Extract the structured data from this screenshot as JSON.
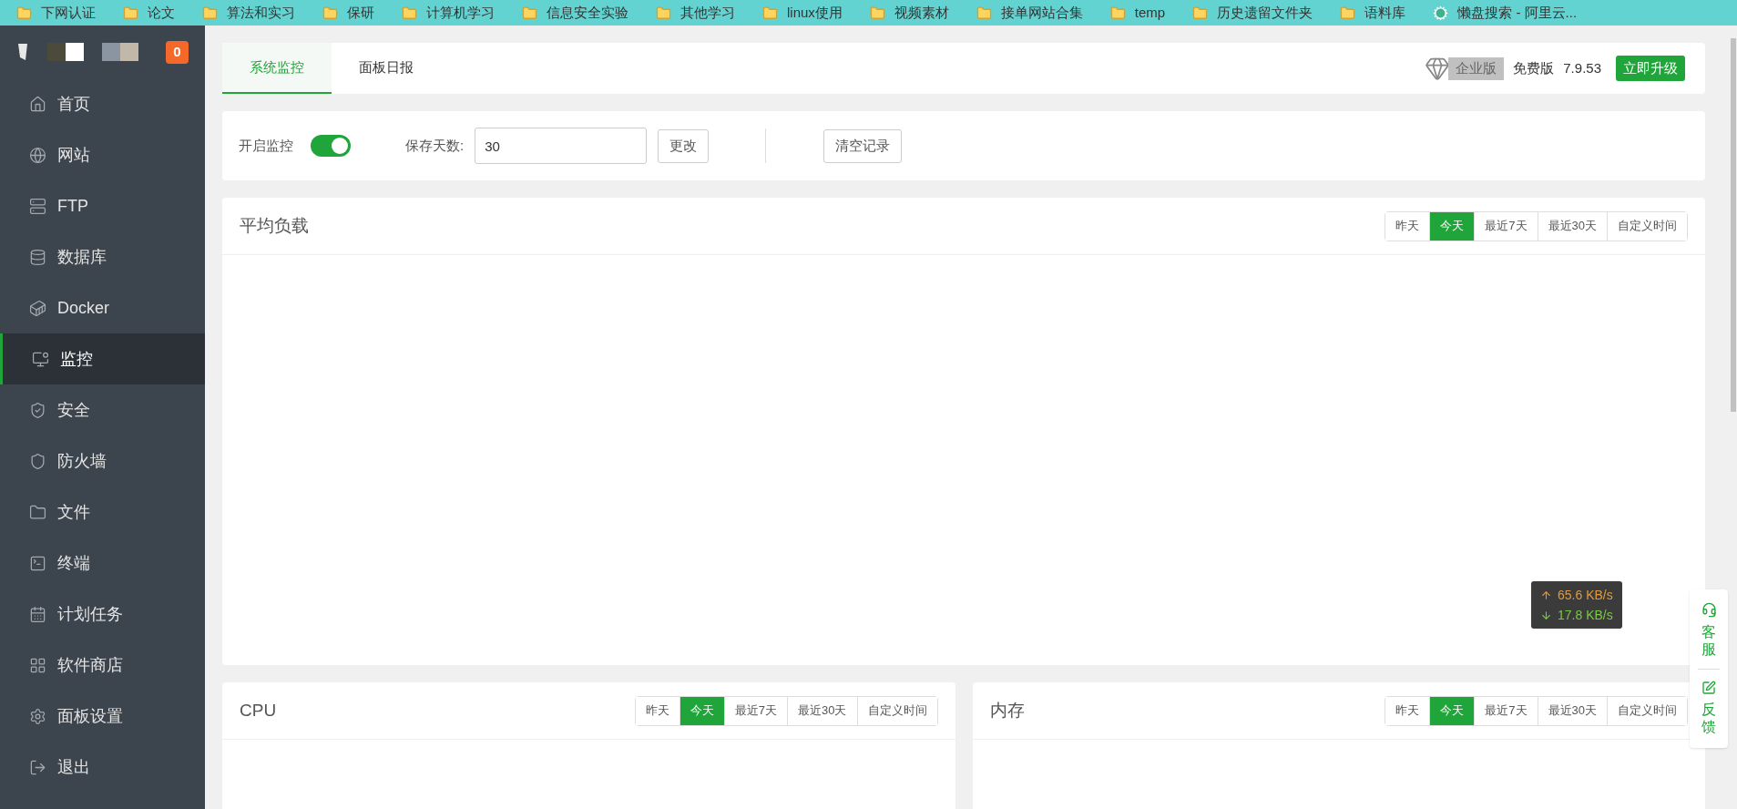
{
  "bookmarks": [
    {
      "label": "下网认证",
      "kind": "folder"
    },
    {
      "label": "论文",
      "kind": "folder"
    },
    {
      "label": "算法和实习",
      "kind": "folder"
    },
    {
      "label": "保研",
      "kind": "folder"
    },
    {
      "label": "计算机学习",
      "kind": "folder"
    },
    {
      "label": "信息安全实验",
      "kind": "folder"
    },
    {
      "label": "其他学习",
      "kind": "folder"
    },
    {
      "label": "linux使用",
      "kind": "folder"
    },
    {
      "label": "视频素材",
      "kind": "folder"
    },
    {
      "label": "接单网站合集",
      "kind": "folder"
    },
    {
      "label": "temp",
      "kind": "folder"
    },
    {
      "label": "历史遗留文件夹",
      "kind": "folder"
    },
    {
      "label": "语料库",
      "kind": "folder"
    },
    {
      "label": "懒盘搜索 - 阿里云...",
      "kind": "site"
    }
  ],
  "sidebar": {
    "badge": "0",
    "items": [
      {
        "label": "首页",
        "kind": "home",
        "selected": false
      },
      {
        "label": "网站",
        "kind": "globe",
        "selected": false
      },
      {
        "label": "FTP",
        "kind": "ftp",
        "selected": false
      },
      {
        "label": "数据库",
        "kind": "database",
        "selected": false
      },
      {
        "label": "Docker",
        "kind": "docker",
        "selected": false
      },
      {
        "label": "监控",
        "kind": "monitor",
        "selected": true
      },
      {
        "label": "安全",
        "kind": "security",
        "selected": false
      },
      {
        "label": "防火墙",
        "kind": "firewall",
        "selected": false
      },
      {
        "label": "文件",
        "kind": "files",
        "selected": false
      },
      {
        "label": "终端",
        "kind": "terminal",
        "selected": false
      },
      {
        "label": "计划任务",
        "kind": "calendar",
        "selected": false
      },
      {
        "label": "软件商店",
        "kind": "store",
        "selected": false
      },
      {
        "label": "面板设置",
        "kind": "settings",
        "selected": false
      },
      {
        "label": "退出",
        "kind": "logout",
        "selected": false
      }
    ]
  },
  "tabs": [
    {
      "label": "系统监控",
      "selected": true
    },
    {
      "label": "面板日报",
      "selected": false
    }
  ],
  "edition": {
    "enterprise": "企业版",
    "current": "免费版",
    "version": "7.9.53",
    "upgrade": "立即升级"
  },
  "controls": {
    "monitor_label": "开启监控",
    "monitor_on": true,
    "days_label": "保存天数:",
    "days_value": "30",
    "change": "更改",
    "clear": "清空记录"
  },
  "panels": [
    {
      "title": "平均负载",
      "ranges": [
        {
          "label": "昨天",
          "selected": false
        },
        {
          "label": "今天",
          "selected": true
        },
        {
          "label": "最近7天",
          "selected": false
        },
        {
          "label": "最近30天",
          "selected": false
        },
        {
          "label": "自定义时间",
          "selected": false
        }
      ]
    },
    {
      "title": "CPU",
      "ranges": [
        {
          "label": "昨天",
          "selected": false
        },
        {
          "label": "今天",
          "selected": true
        },
        {
          "label": "最近7天",
          "selected": false
        },
        {
          "label": "最近30天",
          "selected": false
        },
        {
          "label": "自定义时间",
          "selected": false
        }
      ]
    },
    {
      "title": "内存",
      "ranges": [
        {
          "label": "昨天",
          "selected": false
        },
        {
          "label": "今天",
          "selected": true
        },
        {
          "label": "最近7天",
          "selected": false
        },
        {
          "label": "最近30天",
          "selected": false
        },
        {
          "label": "自定义时间",
          "selected": false
        }
      ]
    }
  ],
  "network": {
    "up": "65.6 KB/s",
    "down": "17.8 KB/s"
  },
  "float": {
    "service": "客服",
    "feedback": "反馈"
  }
}
